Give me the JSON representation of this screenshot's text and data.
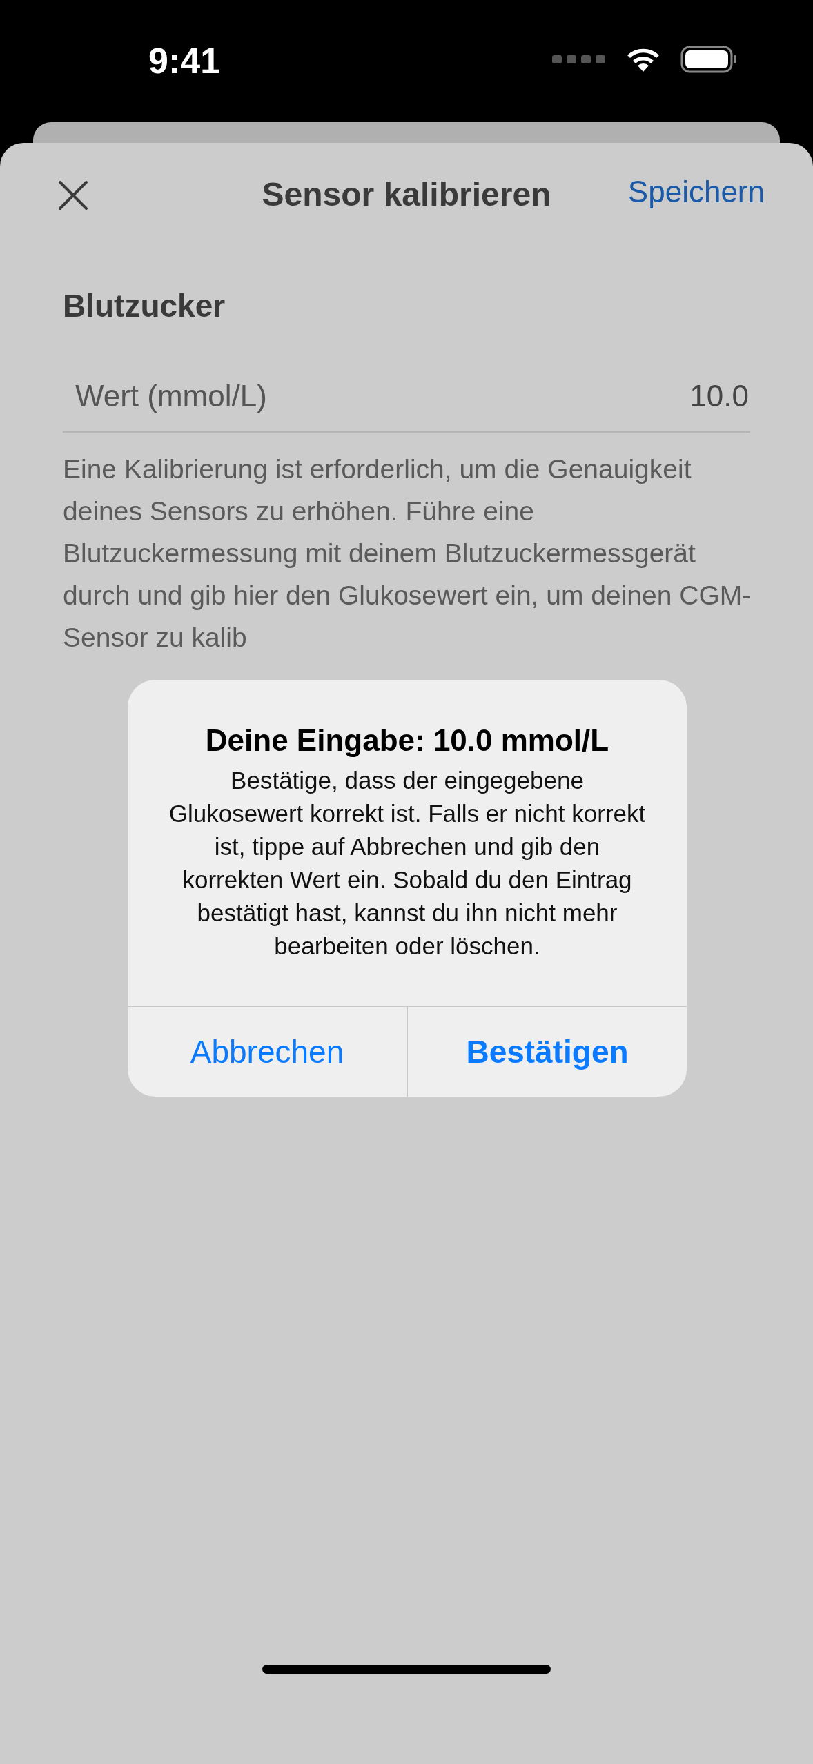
{
  "status_bar": {
    "time": "9:41"
  },
  "header": {
    "title": "Sensor kalibrieren",
    "action": "Speichern"
  },
  "section": {
    "title": "Blutzucker",
    "field": {
      "label": "Wert (mmol/L)",
      "value": "10.0"
    }
  },
  "description": "Eine Kalibrierung ist erforderlich, um die Genauigkeit deines Sensors zu erhöhen. Führe eine Blutzuckermessung mit deinem Blutzuckermessgerät durch und gib hier den Glukosewert ein, um deinen CGM-Sensor zu kalib",
  "alert": {
    "title": "Deine Eingabe: 10.0 mmol/L",
    "message": "Bestätige, dass der eingegebene Glukosewert korrekt ist. Falls er nicht korrekt ist, tippe auf Abbrechen und gib den korrekten Wert ein. Sobald du den Eintrag bestätigt hast, kannst du ihn nicht mehr bearbeiten oder löschen.",
    "buttons": [
      {
        "label": "Abbrechen",
        "kind": "cancel"
      },
      {
        "label": "Bestätigen",
        "kind": "default"
      }
    ]
  }
}
